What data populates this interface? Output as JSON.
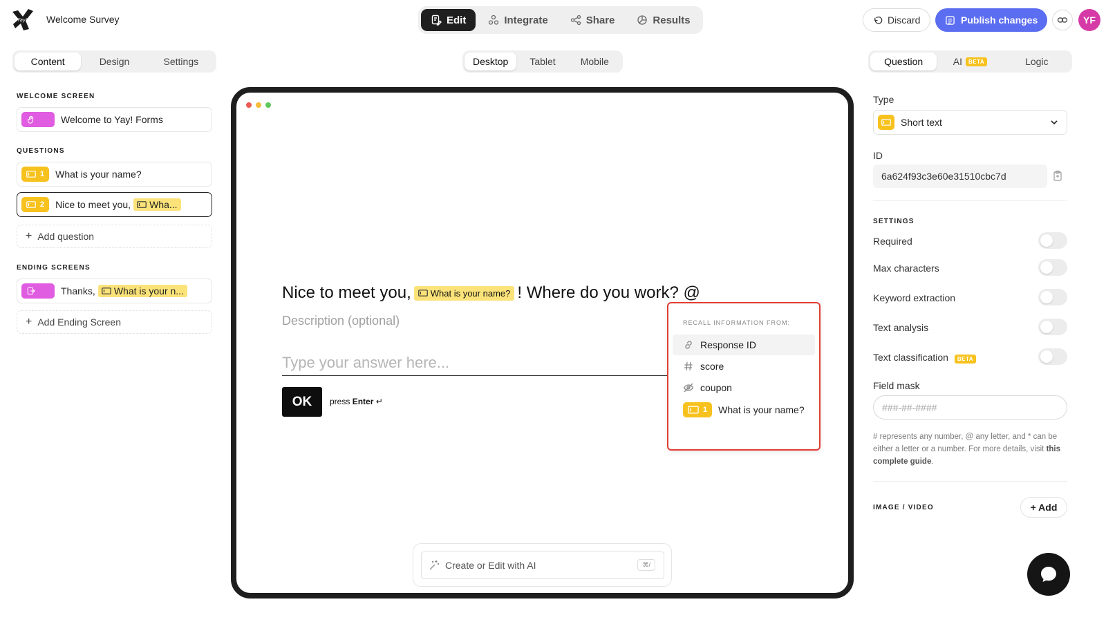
{
  "header": {
    "form_title": "Welcome Survey",
    "nav": [
      {
        "label": "Edit",
        "icon": "edit-icon",
        "active": true
      },
      {
        "label": "Integrate",
        "icon": "integrate-icon",
        "active": false
      },
      {
        "label": "Share",
        "icon": "share-icon",
        "active": false
      },
      {
        "label": "Results",
        "icon": "results-icon",
        "active": false
      }
    ],
    "discard_label": "Discard",
    "publish_label": "Publish changes",
    "avatar_initials": "YF",
    "accent_color": "#5b6df0"
  },
  "left_panel": {
    "tabs": [
      "Content",
      "Design",
      "Settings"
    ],
    "active_tab": "Content",
    "welcome_section": "WELCOME SCREEN",
    "welcome_item": "Welcome to Yay! Forms",
    "questions_section": "QUESTIONS",
    "questions": [
      {
        "number": "1",
        "text": "What is your name?"
      },
      {
        "number": "2",
        "text": "Nice to meet you,",
        "recall": "Wha..."
      }
    ],
    "add_question": "Add question",
    "ending_section": "ENDING SCREENS",
    "ending_item": {
      "text": "Thanks,",
      "recall": "What is your n..."
    },
    "add_ending": "Add Ending Screen"
  },
  "preview": {
    "device_tabs": [
      "Desktop",
      "Tablet",
      "Mobile"
    ],
    "active_device": "Desktop",
    "question_prefix": "Nice to meet you,",
    "question_recall": "What is your name?",
    "question_suffix": "! Where do you work? @",
    "description_placeholder": "Description (optional)",
    "answer_placeholder": "Type your answer here...",
    "ok_label": "OK",
    "press_label": "press",
    "enter_label": "Enter",
    "enter_symbol": "↵",
    "ai_placeholder": "Create or Edit with AI",
    "ai_shortcut": "⌘/"
  },
  "recall_menu": {
    "header": "RECALL INFORMATION FROM:",
    "items": [
      {
        "label": "Response ID",
        "icon": "link-icon"
      },
      {
        "label": "score",
        "icon": "hash-icon"
      },
      {
        "label": "coupon",
        "icon": "hidden-eye-icon"
      },
      {
        "label": "What is your name?",
        "icon": "short-text-icon",
        "number": "1"
      }
    ]
  },
  "right_panel": {
    "tabs": [
      "Question",
      "AI",
      "Logic"
    ],
    "active_tab": "Question",
    "beta_label": "BETA",
    "type_label": "Type",
    "type_value": "Short text",
    "id_label": "ID",
    "id_value": "6a624f93c3e60e31510cbc7d",
    "settings_section": "SETTINGS",
    "settings": [
      "Required",
      "Max characters",
      "Keyword extraction",
      "Text analysis",
      "Text classification"
    ],
    "field_mask_label": "Field mask",
    "field_mask_placeholder": "###-##-####",
    "help_text": "# represents any number, @ any letter, and * can be either a letter or a number. For more details, visit",
    "help_link": "this complete guide",
    "help_end": ".",
    "image_video_section": "IMAGE / VIDEO",
    "add_label": "+ Add"
  }
}
